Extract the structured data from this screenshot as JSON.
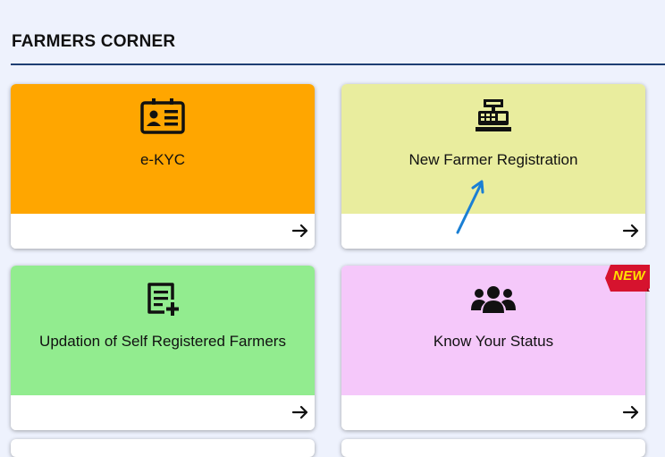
{
  "section": {
    "title": "FARMERS CORNER"
  },
  "cards": [
    {
      "label": "e-KYC",
      "icon": "id-card-icon",
      "color": "#ffa600"
    },
    {
      "label": "New Farmer Registration",
      "icon": "cash-register-icon",
      "color": "#e9ed9e"
    },
    {
      "label": "Updation of Self Registered Farmers",
      "icon": "edit-document-icon",
      "color": "#92ec8f"
    },
    {
      "label": "Know Your Status",
      "icon": "users-icon",
      "color": "#f5c8fa"
    }
  ],
  "badge": {
    "text": "NEW",
    "color": "#d6132e"
  },
  "annotation": {
    "icon": "blue-arrow-icon",
    "color": "#1a7fd4"
  }
}
